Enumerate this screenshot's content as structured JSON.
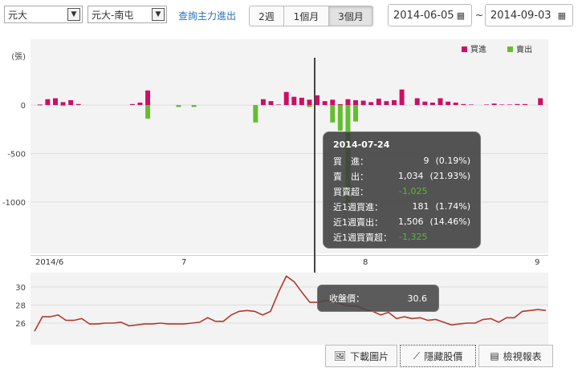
{
  "filters": {
    "broker": "元大",
    "branch": "元大-南屯",
    "query_link": "查詢主力進出",
    "periods": [
      "2週",
      "1個月",
      "3個月"
    ],
    "active_period": "3個月",
    "start_date": "2014-06-05",
    "end_date": "2014-09-03",
    "date_separator": "~"
  },
  "legend": {
    "buy": "買進",
    "sell": "賣出"
  },
  "colors": {
    "buy": "#cc0e66",
    "sell": "#64bd2e",
    "price_line": "#b03a2e"
  },
  "volume_chart": {
    "y_unit": "(張)",
    "y_ticks": [
      "0",
      "-500",
      "-1000"
    ],
    "x_ticks": [
      "2014/6",
      "7",
      "8",
      "9"
    ]
  },
  "price_chart": {
    "y_ticks": [
      "30",
      "28",
      "26"
    ]
  },
  "chart_data": [
    {
      "type": "bar",
      "y_unit": "(張)",
      "ylim": [
        -1500,
        150
      ],
      "x_ticks": [
        "2014/6",
        "7",
        "8",
        "9"
      ],
      "series": [
        {
          "name": "買進",
          "values": [
            5,
            60,
            70,
            30,
            50,
            10,
            0,
            0,
            0,
            0,
            0,
            0,
            10,
            25,
            150,
            0,
            0,
            0,
            0,
            0,
            0,
            0,
            0,
            0,
            0,
            0,
            0,
            0,
            0,
            60,
            40,
            5,
            135,
            85,
            75,
            55,
            100,
            40,
            55,
            9,
            60,
            50,
            45,
            30,
            65,
            40,
            50,
            160,
            0,
            70,
            35,
            25,
            70,
            35,
            25,
            10,
            5,
            0,
            5,
            15,
            5,
            5,
            10,
            10,
            0,
            70
          ]
        },
        {
          "name": "賣出",
          "values": [
            5,
            0,
            0,
            10,
            0,
            0,
            0,
            0,
            0,
            0,
            0,
            0,
            0,
            0,
            140,
            0,
            0,
            0,
            20,
            0,
            20,
            0,
            0,
            0,
            0,
            0,
            0,
            0,
            180,
            0,
            0,
            0,
            0,
            0,
            0,
            20,
            0,
            0,
            180,
            265,
            1034,
            170,
            0,
            0,
            0,
            0,
            0,
            0,
            0,
            0,
            0,
            0,
            0,
            0,
            0,
            0,
            0,
            0,
            0,
            0,
            0,
            0,
            0,
            0,
            0,
            0
          ]
        }
      ]
    },
    {
      "type": "line",
      "ylim": [
        24.5,
        31.6
      ],
      "y_ticks": [
        26,
        28,
        30
      ],
      "series": [
        {
          "name": "收盤價",
          "values": [
            25.1,
            26.7,
            26.7,
            26.9,
            26.3,
            26.3,
            26.5,
            25.9,
            25.9,
            26.0,
            26.0,
            26.1,
            25.7,
            25.8,
            25.9,
            25.9,
            26.0,
            25.9,
            25.9,
            25.9,
            26.0,
            26.1,
            26.6,
            26.2,
            26.2,
            26.9,
            27.3,
            27.4,
            27.3,
            26.9,
            27.3,
            29.4,
            31.2,
            30.6,
            29.4,
            28.3,
            28.3,
            28.5,
            28.5,
            28.1,
            27.9,
            27.9,
            27.5,
            27.3,
            26.9,
            27.2,
            26.5,
            26.7,
            26.5,
            26.6,
            26.3,
            26.4,
            26.1,
            25.8,
            25.9,
            26.0,
            26.0,
            26.4,
            26.5,
            26.1,
            26.6,
            26.6,
            27.3,
            27.4,
            27.5,
            27.4
          ]
        }
      ]
    }
  ],
  "tooltip": {
    "date": "2014-07-24",
    "rows": [
      {
        "label": "買　進：",
        "v1": "9",
        "v2": "(0.19%)"
      },
      {
        "label": "賣　出：",
        "v1": "1,034",
        "v2": "(21.93%)"
      },
      {
        "label": "買賣超：",
        "v1": "-1,025",
        "v2": ""
      },
      {
        "label": "近1週買進：",
        "v1": "181",
        "v2": "(1.74%)"
      },
      {
        "label": "近1週賣出：",
        "v1": "1,506",
        "v2": "(14.46%)"
      },
      {
        "label": "近1週買賣超：",
        "v1": "-1,325",
        "v2": ""
      }
    ]
  },
  "price_tooltip": {
    "label": "收盤價：",
    "value": "30.6"
  },
  "buttons": {
    "download": "下載圖片",
    "hide_price": "隱藏股價",
    "view_report": "檢視報表"
  }
}
